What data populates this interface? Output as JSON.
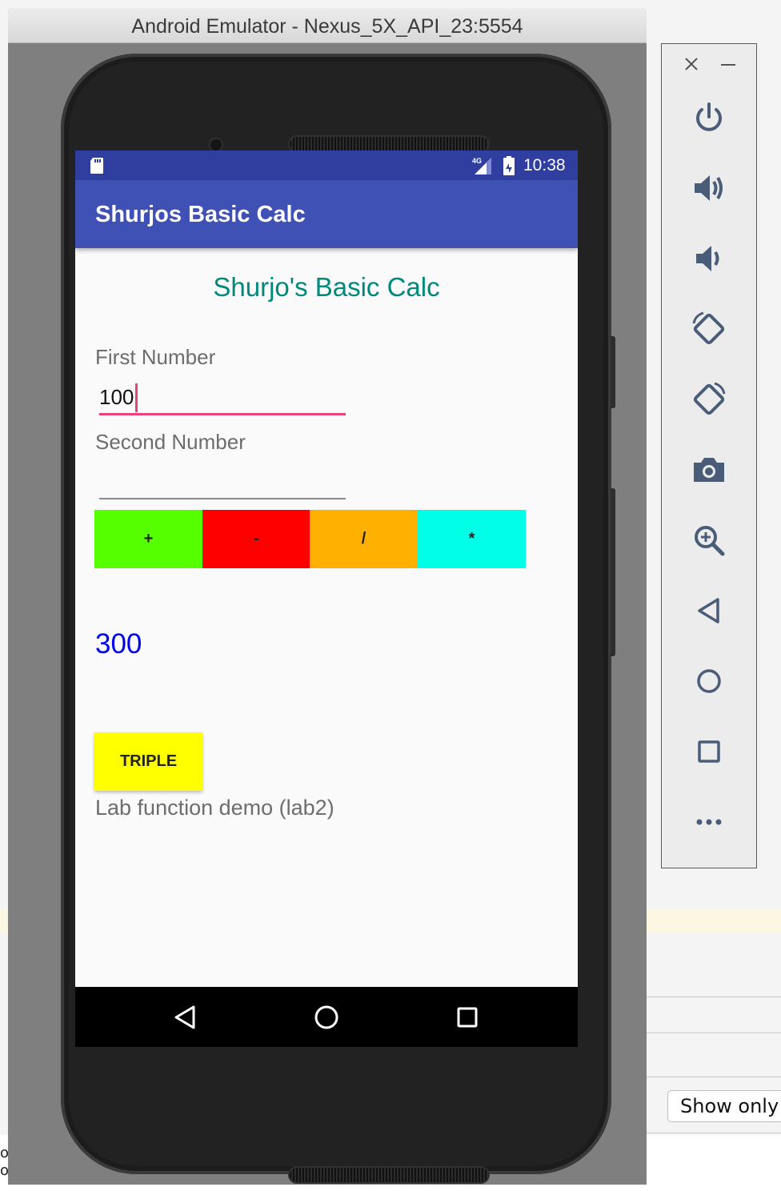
{
  "window": {
    "title": "Android Emulator - Nexus_5X_API_23:5554"
  },
  "status_bar": {
    "network": "4G",
    "time": "10:38"
  },
  "app_bar": {
    "title": "Shurjos Basic Calc"
  },
  "main": {
    "heading": "Shurjo's Basic Calc",
    "first_number": {
      "label": "First Number",
      "value": "100"
    },
    "second_number": {
      "label": "Second Number",
      "value": ""
    },
    "operations": [
      {
        "label": "+",
        "color": "#55ff00"
      },
      {
        "label": "-",
        "color": "#ff0000"
      },
      {
        "label": "/",
        "color": "#ffb000"
      },
      {
        "label": "*",
        "color": "#00ffe6"
      }
    ],
    "result": "300",
    "triple_button": "TRIPLE",
    "footer_text": "Lab function demo (lab2)"
  },
  "nav_bar": {
    "icons": [
      "back-icon",
      "home-icon",
      "recents-icon"
    ]
  },
  "toolbar": {
    "icons": [
      "close-icon",
      "minimize-icon",
      "power-icon",
      "volume-up-icon",
      "volume-down-icon",
      "rotate-left-icon",
      "rotate-right-icon",
      "camera-icon",
      "zoom-icon",
      "back-icon",
      "home-icon",
      "overview-icon",
      "more-icon"
    ]
  },
  "background": {
    "show_only_button": "Show only",
    "left_text": "o\no"
  },
  "colors": {
    "status_bar": "#303f9f",
    "app_bar": "#3f51b5",
    "heading": "#00897b",
    "input_focus": "#ec407a",
    "result": "#0000ee",
    "triple": "#ffff00"
  }
}
